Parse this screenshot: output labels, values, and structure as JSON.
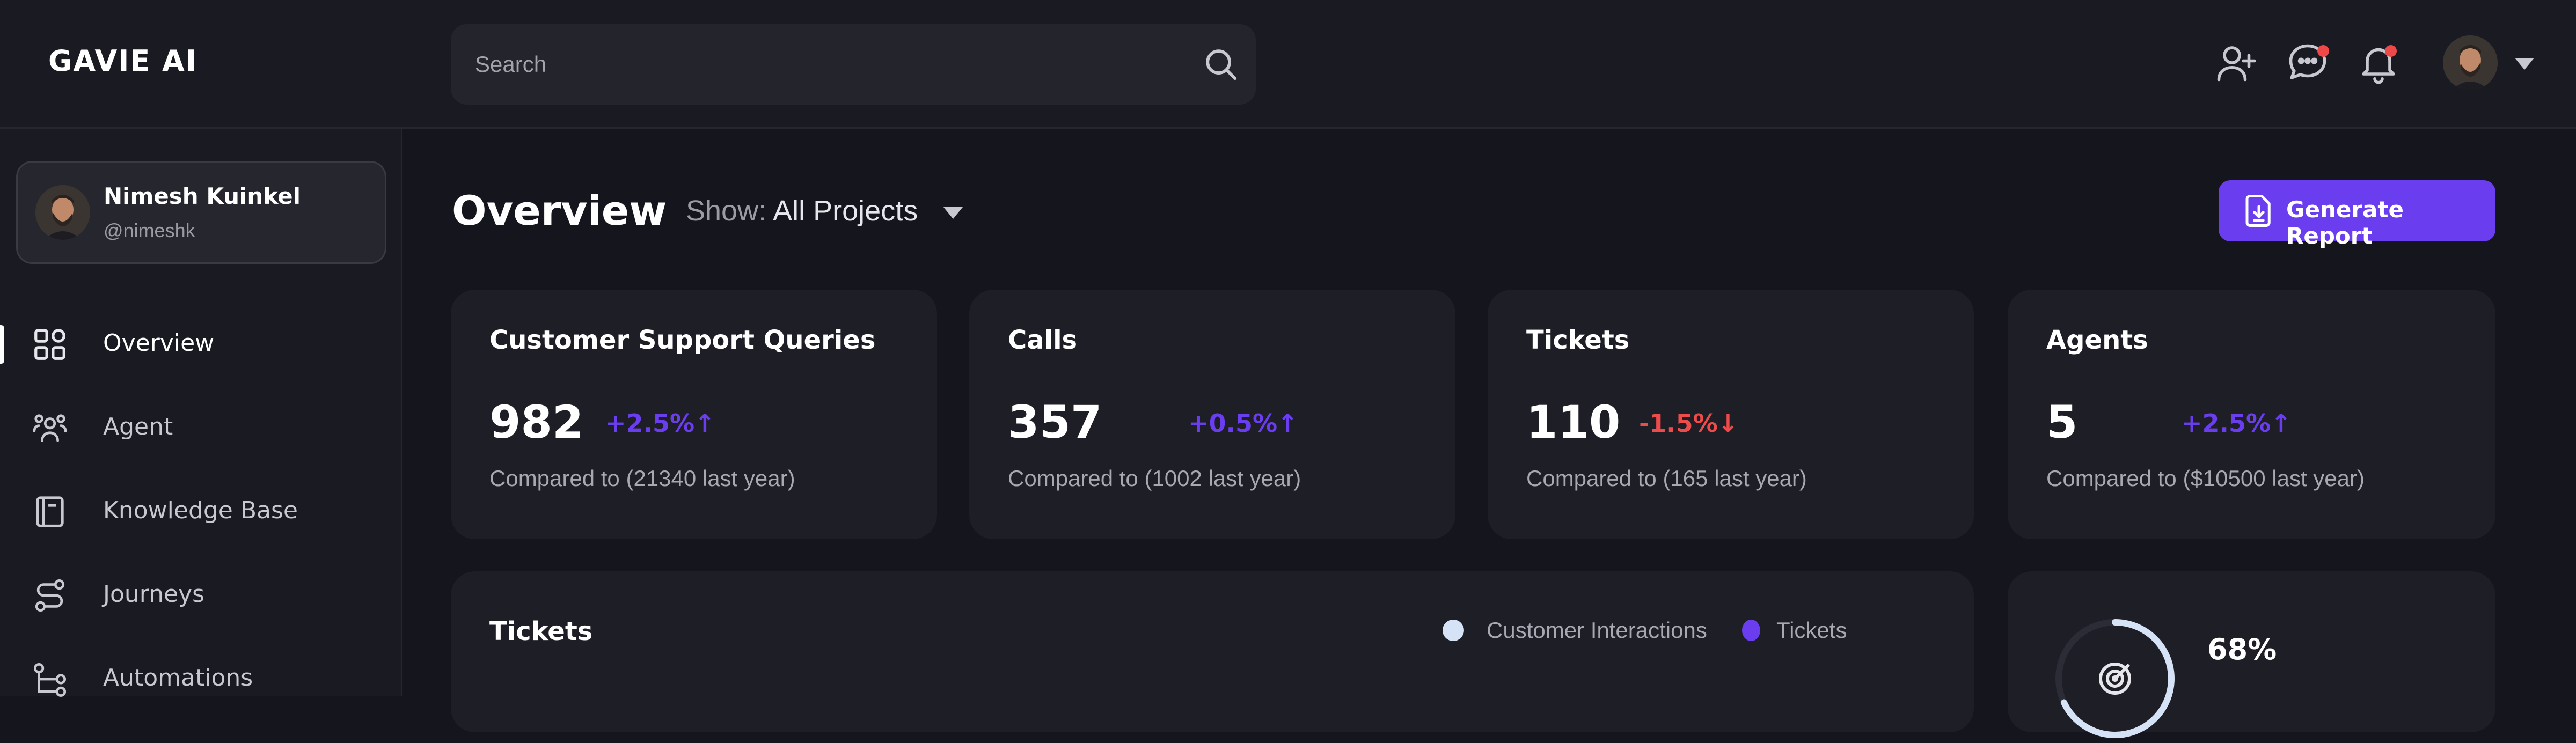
{
  "app": {
    "logo": "GAVIE AI"
  },
  "header": {
    "search_placeholder": "Search"
  },
  "user": {
    "name": "Nimesh Kuinkel",
    "handle": "@nimeshk"
  },
  "sidebar": {
    "items": [
      {
        "label": "Overview",
        "icon": "grid-icon",
        "active": true
      },
      {
        "label": "Agent",
        "icon": "users-icon"
      },
      {
        "label": "Knowledge Base",
        "icon": "book-icon"
      },
      {
        "label": "Journeys",
        "icon": "route-icon"
      },
      {
        "label": "Automations",
        "icon": "flow-icon"
      }
    ]
  },
  "page": {
    "title": "Overview",
    "show_label": "Show:",
    "show_value": "All Projects",
    "generate_label": "Generate Report"
  },
  "stats": [
    {
      "title": "Customer Support Queries",
      "value": "982",
      "delta": "+2.5%",
      "trend": "up",
      "compare": "Compared to (21340 last year)"
    },
    {
      "title": "Calls",
      "value": "357",
      "delta": "+0.5%",
      "trend": "up",
      "compare": "Compared to (1002 last year)"
    },
    {
      "title": "Tickets",
      "value": "110",
      "delta": "-1.5%",
      "trend": "down",
      "compare": "Compared to (165 last year)"
    },
    {
      "title": "Agents",
      "value": "5",
      "delta": "+2.5%",
      "trend": "up",
      "compare": "Compared to ($10500 last year)"
    }
  ],
  "tickets_panel": {
    "title": "Tickets",
    "legend": [
      {
        "label": "Customer Interactions",
        "color": "#d6e2f5"
      },
      {
        "label": "Tickets",
        "color": "#6a3dee"
      }
    ]
  },
  "goal_panel": {
    "percent": "68%",
    "progress": 0.68
  },
  "colors": {
    "accent": "#6a3dee",
    "negative": "#ee4b4b",
    "bg": "#15151d",
    "card": "#1e1e26"
  }
}
